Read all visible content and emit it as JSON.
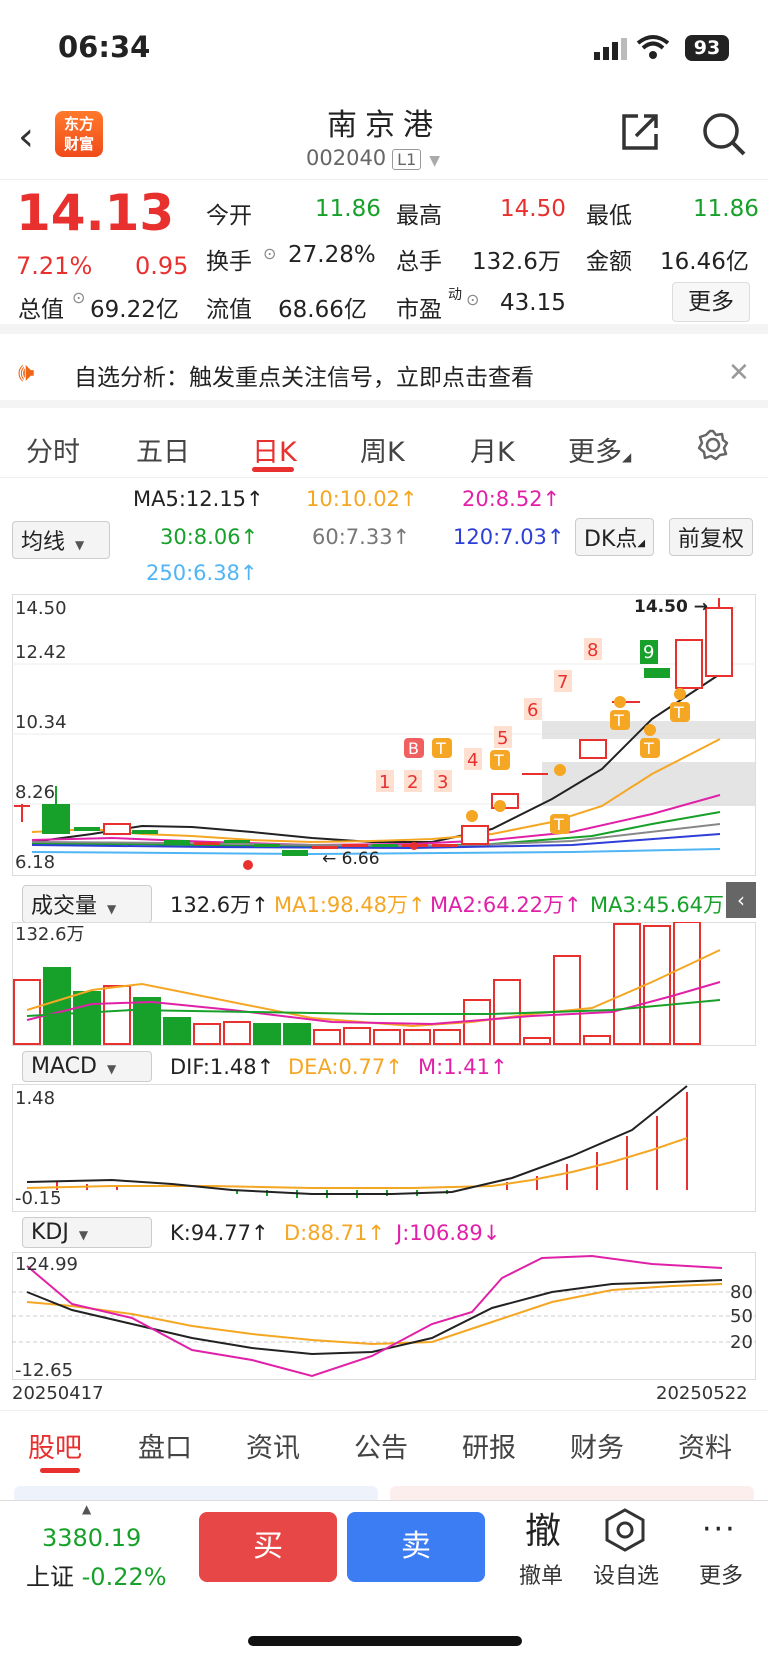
{
  "status_bar": {
    "time": "06:34",
    "battery": "93"
  },
  "header": {
    "name": "南京港",
    "code": "002040",
    "level": "L1",
    "logo_text": "东方财富"
  },
  "quote": {
    "price": "14.13",
    "pct": "7.21%",
    "change": "0.95",
    "open_label": "今开",
    "open": "11.86",
    "high_label": "最高",
    "high": "14.50",
    "low_label": "最低",
    "low": "11.86",
    "turnover_label": "换手",
    "turnover": "27.28%",
    "vol_label": "总手",
    "vol": "132.6万",
    "amount_label": "金额",
    "amount": "16.46亿",
    "mktcap_label": "总值",
    "mktcap": "69.22亿",
    "float_label": "流值",
    "float": "68.66亿",
    "pe_label": "市盈",
    "pe_sup": "动",
    "pe": "43.15",
    "more": "更多"
  },
  "notice": {
    "text": "自选分析：触发重点关注信号，立即点击查看"
  },
  "tabs": [
    "分时",
    "五日",
    "日K",
    "周K",
    "月K",
    "更多"
  ],
  "active_tab": "日K",
  "ma": {
    "selector": "均线",
    "ma5": "MA5:12.15↑",
    "ma10": "10:10.02↑",
    "ma20": "20:8.52↑",
    "ma30": "30:8.06↑",
    "ma60": "60:7.33↑",
    "ma120": "120:7.03↑",
    "ma250": "250:6.38↑",
    "dk": "DK点",
    "adjust": "前复权"
  },
  "price_axis": [
    "14.50",
    "12.42",
    "10.34",
    "8.26",
    "6.18"
  ],
  "marks": {
    "high": "14.50",
    "low": "6.66"
  },
  "volume": {
    "selector": "成交量",
    "vol": "132.6万↑",
    "ma1": "MA1:98.48万↑",
    "ma2": "MA2:64.22万↑",
    "ma3": "MA3:45.64万↑",
    "axis_top": "132.6万"
  },
  "macd": {
    "selector": "MACD",
    "dif": "DIF:1.48↑",
    "dea": "DEA:0.77↑",
    "m": "M:1.41↑",
    "axis_top": "1.48",
    "axis_bottom": "-0.15"
  },
  "kdj": {
    "selector": "KDJ",
    "k": "K:94.77↑",
    "d": "D:88.71↑",
    "j": "J:106.89↓",
    "axis_top": "124.99",
    "axis_bottom": "-12.65",
    "r80": "80",
    "r50": "50",
    "r20": "20"
  },
  "dates": {
    "start": "20250417",
    "end": "20250522"
  },
  "bottom_tabs": [
    "股吧",
    "盘口",
    "资讯",
    "公告",
    "研报",
    "财务",
    "资料"
  ],
  "index": {
    "value": "3380.19",
    "name": "上证",
    "pct": "-0.22%"
  },
  "actions": {
    "buy": "买",
    "sell": "卖",
    "cancel_icon": "撤",
    "cancel": "撤单",
    "watch": "设自选",
    "more": "更多"
  },
  "colors": {
    "up": "#e8302f",
    "down": "#17a12a",
    "accent": "#e8302f",
    "sell": "#3d7df3"
  }
}
